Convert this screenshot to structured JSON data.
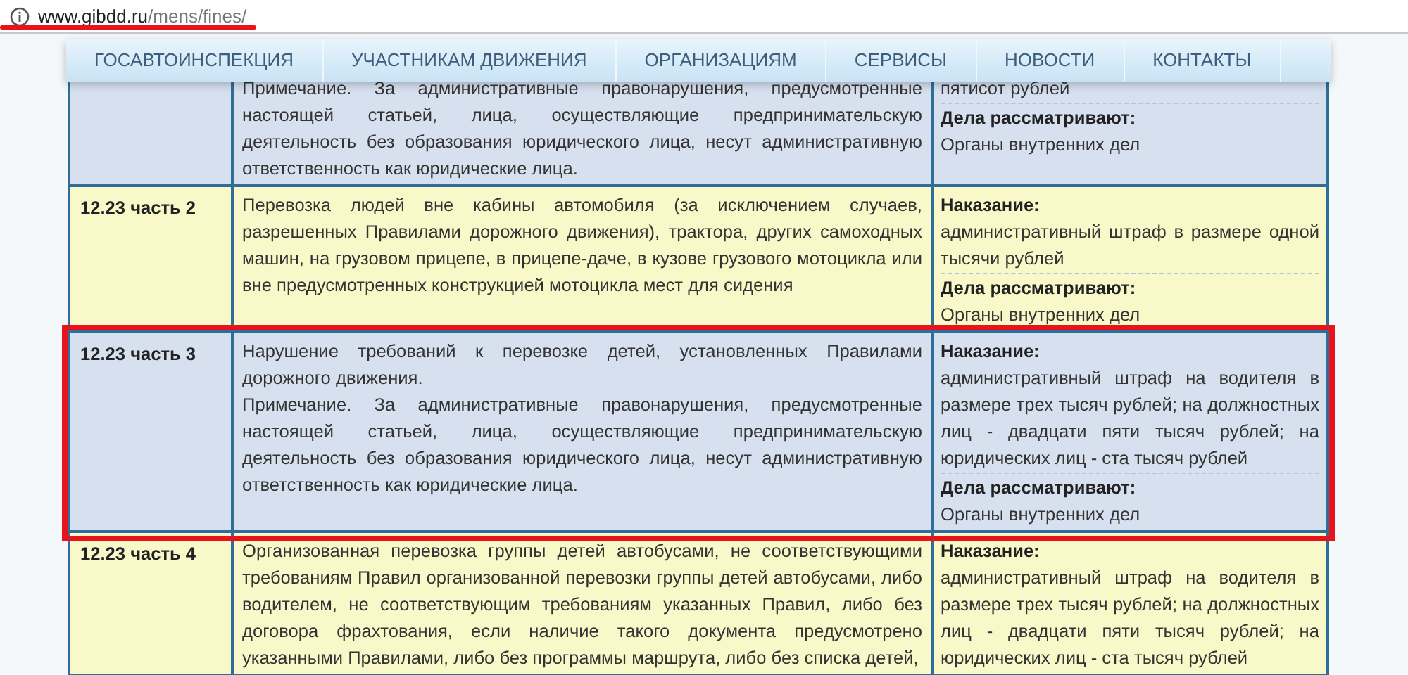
{
  "address_bar": {
    "host": "www.gibdd.ru",
    "path": "/mens/fines/",
    "underlined": true
  },
  "nav": [
    "ГОСАВТОИНСПЕКЦИЯ",
    "УЧАСТНИКАМ ДВИЖЕНИЯ",
    "ОРГАНИЗАЦИЯМ",
    "СЕРВИСЫ",
    "НОВОСТИ",
    "КОНТАКТЫ"
  ],
  "rows": [
    {
      "article": "",
      "description": [
        "Примечание. За административные правонарушения, предусмотренные настоящей статьей, лица, осуществляющие предпринимательскую деятельность без образования юридического лица, несут административную ответственность как юридические лица."
      ],
      "penalty_label": "",
      "penalty": "пятисот рублей",
      "authority_label": "Дела рассматривают:",
      "authority": "Органы внутренних дел",
      "highlighted": false
    },
    {
      "article": "12.23 часть 2",
      "description": [
        "Перевозка людей вне кабины автомобиля (за исключением случаев, разрешенных Правилами дорожного движения), трактора, других самоходных машин, на грузовом прицепе, в прицепе-даче, в кузове грузового мотоцикла или вне предусмотренных конструкцией мотоцикла мест для сидения"
      ],
      "penalty_label": "Наказание:",
      "penalty": "административный штраф в размере одной тысячи рублей",
      "authority_label": "Дела рассматривают:",
      "authority": "Органы внутренних дел",
      "highlighted": false
    },
    {
      "article": "12.23 часть 3",
      "description": [
        "Нарушение требований к перевозке детей, установленных Правилами дорожного движения.",
        "Примечание. За административные правонарушения, предусмотренные настоящей статьей, лица, осуществляющие предпринимательскую деятельность без образования юридического лица, несут административную ответственность как юридические лица."
      ],
      "penalty_label": "Наказание:",
      "penalty": "административный штраф на водителя в размере трех тысяч рублей; на должностных лиц - двадцати пяти тысяч рублей; на юридических лиц - ста тысяч рублей",
      "authority_label": "Дела рассматривают:",
      "authority": "Органы внутренних дел",
      "highlighted": true
    },
    {
      "article": "12.23 часть 4",
      "description": [
        "Организованная перевозка группы детей автобусами, не соответствующими требованиям Правил организованной перевозки группы детей автобусами, либо водителем, не соответствующим требованиям указанных Правил, либо без договора фрахтования, если наличие такого документа предусмотрено указанными Правилами, либо без программы маршрута, либо без списка детей,"
      ],
      "penalty_label": "Наказание:",
      "penalty": "административный штраф на водителя в размере трех тысяч рублей; на должностных лиц - двадцати пяти тысяч рублей; на юридических лиц - ста тысяч рублей",
      "authority_label": "",
      "authority": "",
      "highlighted": false
    }
  ]
}
